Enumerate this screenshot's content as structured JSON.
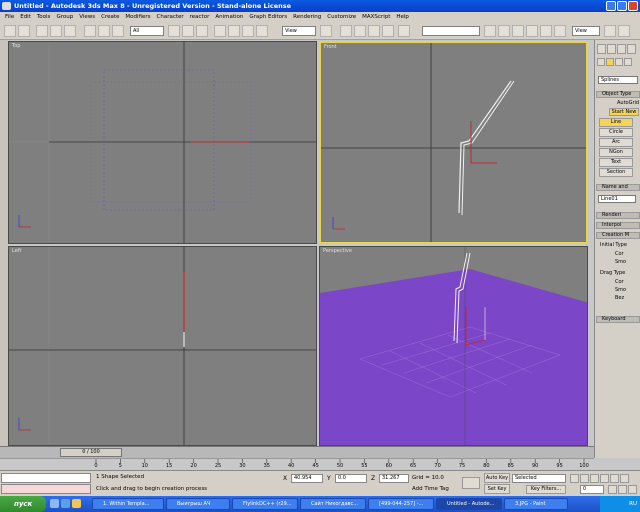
{
  "titlebar": {
    "title": "Untitled - Autodesk 3ds Max 8 - Unregistered Version - Stand-alone License",
    "tab_text": "Untitled · Untitled - Autodesk 3ds Max 8 - Unregistered Version · Stand-alone License"
  },
  "menu": [
    "File",
    "Edit",
    "Tools",
    "Group",
    "Views",
    "Create",
    "Modifiers",
    "Character",
    "reactor",
    "Animation",
    "Graph Editors",
    "Rendering",
    "Customize",
    "MAXScript",
    "Help"
  ],
  "toolbar": {
    "selection_filter": "All",
    "ref_coord": "View",
    "named_sel": "",
    "view_dropdown": "View"
  },
  "viewports": {
    "top": "Top",
    "front": "Front",
    "left": "Left",
    "perspective": "Perspective"
  },
  "cmd": {
    "category": "Splines",
    "object_type_head": "Object Type",
    "autogrid": "AutoGrid",
    "start_new_shape": "Start New",
    "buttons": [
      "Line",
      "Circle",
      "Arc",
      "NGon",
      "Text",
      "Section"
    ],
    "name_color_head": "Name and",
    "object_name": "Line01",
    "rollouts": [
      "Renderi",
      "Interpol",
      "Creation M"
    ],
    "initial_type_label": "Initial Type",
    "initial_type_options": [
      "Cor",
      "Smo"
    ],
    "drag_type_label": "Drag Type",
    "drag_type_options": [
      "Cor",
      "Smo",
      "Bez"
    ],
    "keyboard_head": "Keyboard"
  },
  "timeline": {
    "frame_display": "0 / 100",
    "ticks": [
      "0",
      "5",
      "10",
      "15",
      "20",
      "25",
      "30",
      "35",
      "40",
      "45",
      "50",
      "55",
      "60",
      "65",
      "70",
      "75",
      "80",
      "85",
      "90",
      "95",
      "100"
    ]
  },
  "status": {
    "selection": "1 Shape Selected",
    "prompt": "Click and drag to begin creation process",
    "x_label": "X",
    "x": "40.954",
    "y_label": "Y",
    "y": "0.0",
    "z_label": "Z",
    "z": "31.267",
    "grid": "Grid = 10.0",
    "add_time_tag": "Add Time Tag",
    "auto_key": "Auto Key",
    "set_key": "Set Key",
    "selected": "Selected",
    "key_filters": "Key Filters...",
    "frame": "0"
  },
  "taskbar": {
    "start": "пуск",
    "tasks": [
      "1. Within Templa...",
      "Выигрыш АЧ",
      "FlylinkDC++ (r29...",
      "Сайт Никогдавс...",
      "[499-044-257] -...",
      "Untitled - Autode...",
      "3.JPG - Paint"
    ],
    "lang": "RU"
  },
  "colors": {
    "accent_yellow": "#e6d44a",
    "perspective_plane": "#7b46c8",
    "selection_red": "#c8252a"
  }
}
